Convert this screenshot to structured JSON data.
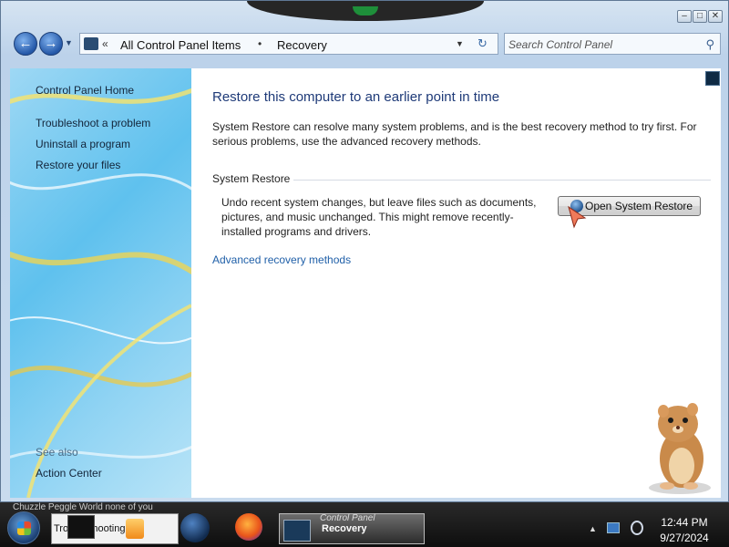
{
  "window": {
    "caption_buttons": [
      "minimize",
      "maximize",
      "close"
    ]
  },
  "navigation": {
    "breadcrumb": [
      "All Control Panel Items",
      "Recovery"
    ],
    "search_placeholder": "Search Control Panel"
  },
  "sidebar": {
    "home_link": "Control Panel Home",
    "tasks": [
      "Troubleshoot a problem",
      "Uninstall a program",
      "Restore your files"
    ],
    "see_also_heading": "See also",
    "see_also_links": [
      "Action Center"
    ]
  },
  "main": {
    "heading": "Restore this computer to an earlier point in time",
    "description": "System Restore can resolve many system problems, and is the best recovery method to try first. For serious problems, use the advanced recovery methods.",
    "system_restore": {
      "group_label": "System Restore",
      "text": "Undo recent system changes, but leave files such as documents, pictures, and music unchanged. This might remove recently-installed programs and drivers.",
      "button_label": "Open System Restore"
    },
    "advanced_link": "Advanced recovery methods"
  },
  "taskbar": {
    "window_titles": "Chuzzle   Peggle World   none of you",
    "items": {
      "troubleshooting_label": "Troubleshooting",
      "control_panel_title": "Control Panel",
      "control_panel_subtitle": "Recovery"
    },
    "clock": {
      "time": "12:44 PM",
      "date": "9/27/2024"
    }
  },
  "colors": {
    "heading": "#1e3a78",
    "link": "#1f5fa8",
    "sidebar_gradient": "#5fc1ee"
  }
}
